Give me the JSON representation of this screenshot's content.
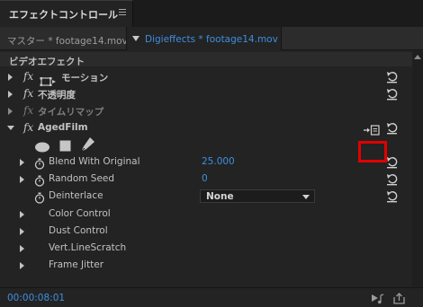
{
  "panel_tab": {
    "label": "エフェクトコントロール",
    "menu_icon": "hamburger-icon"
  },
  "clips": {
    "master": "マスター * footage14.mov",
    "active": "Digieffects * footage14.mov"
  },
  "section_header": "ビデオエフェクト",
  "effects": {
    "motion": "モーション",
    "opacity": "不透明度",
    "time_remap": "タイムリマップ",
    "aged_film": "AgedFilm"
  },
  "fx_symbol": "fx",
  "properties": {
    "blend_with_original": {
      "label": "Blend With Original",
      "value": "25.000"
    },
    "random_seed": {
      "label": "Random Seed",
      "value": "0"
    },
    "deinterlace": {
      "label": "Deinterlace",
      "value": "None"
    }
  },
  "groups": {
    "color_control": "Color Control",
    "dust_control": "Dust Control",
    "vert_linescratch": "Vert.LineScratch",
    "frame_jitter": "Frame Jitter"
  },
  "footer": {
    "timecode": "00:00:08:01"
  },
  "colors": {
    "accent": "#3f8ede",
    "highlight": "#e00000"
  }
}
